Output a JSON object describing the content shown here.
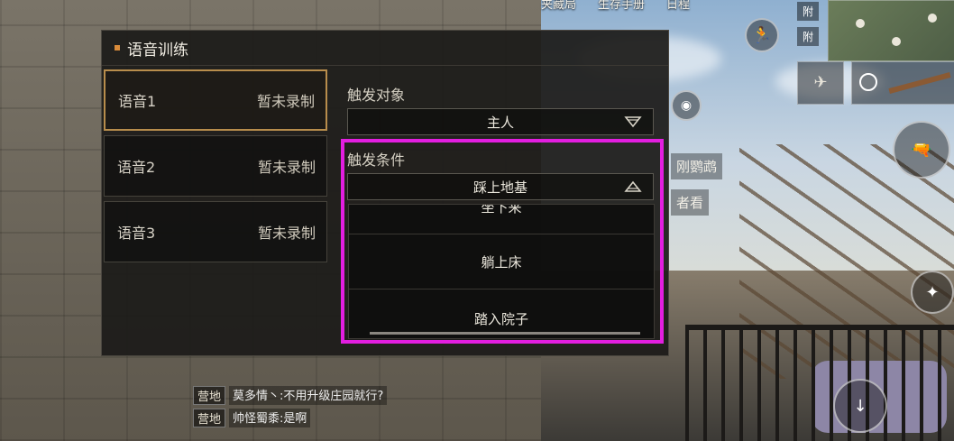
{
  "hud": {
    "top_tabs": [
      "夹藏局",
      "生存手册",
      "日程"
    ],
    "side_labels": [
      "附",
      "附"
    ],
    "side_text_1": "刚鹦鹉",
    "side_text_2": "者看"
  },
  "panel": {
    "title": "语音训练",
    "voices": [
      {
        "label": "语音1",
        "status": "暂未录制",
        "selected": true
      },
      {
        "label": "语音2",
        "status": "暂未录制",
        "selected": false
      },
      {
        "label": "语音3",
        "status": "暂未录制",
        "selected": false
      }
    ],
    "trigger_target": {
      "label": "触发对象",
      "value": "主人"
    },
    "trigger_condition": {
      "label": "触发条件",
      "value": "踩上地基",
      "options": [
        "坐下来",
        "躺上床",
        "踏入院子"
      ]
    }
  },
  "chat": {
    "lines": [
      {
        "tag": "营地",
        "text": "莫多情丶:不用升级庄园就行?"
      },
      {
        "tag": "营地",
        "text": "帅怪蜀黍:是啊"
      }
    ]
  },
  "colors": {
    "accent": "#d98b3a",
    "highlight": "#e31ee0",
    "selected_border": "#b88d4c"
  }
}
